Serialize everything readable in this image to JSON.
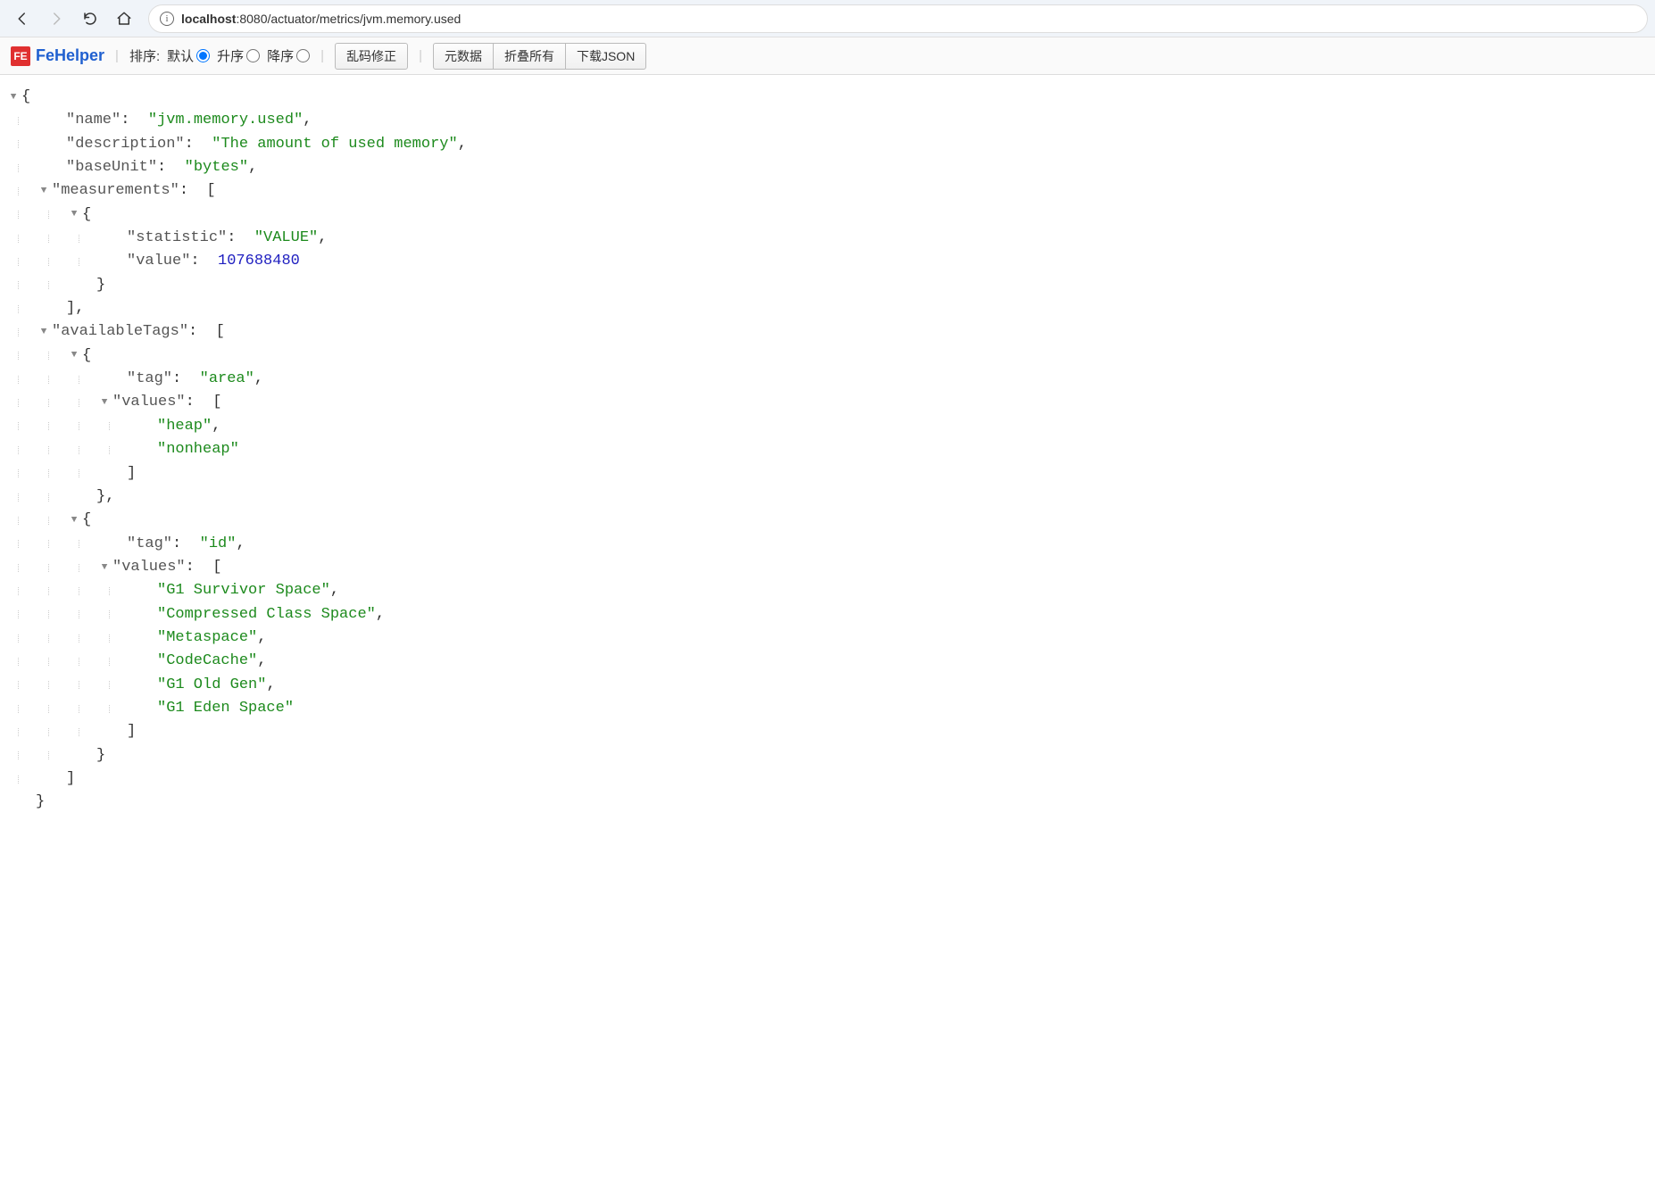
{
  "browser": {
    "url_prefix": "localhost",
    "url_path": ":8080/actuator/metrics/jvm.memory.used"
  },
  "fehelper": {
    "brand": "FeHelper",
    "sort_label": "排序:",
    "sort_default": "默认",
    "sort_asc": "升序",
    "sort_desc": "降序",
    "btn_fix": "乱码修正",
    "btn_meta": "元数据",
    "btn_collapse": "折叠所有",
    "btn_download": "下载JSON"
  },
  "json_body": {
    "name": "jvm.memory.used",
    "description": "The amount of used memory",
    "baseUnit": "bytes",
    "measurements": [
      {
        "statistic": "VALUE",
        "value": 107688480
      }
    ],
    "availableTags": [
      {
        "tag": "area",
        "values": [
          "heap",
          "nonheap"
        ]
      },
      {
        "tag": "id",
        "values": [
          "G1 Survivor Space",
          "Compressed Class Space",
          "Metaspace",
          "CodeCache",
          "G1 Old Gen",
          "G1 Eden Space"
        ]
      }
    ]
  }
}
